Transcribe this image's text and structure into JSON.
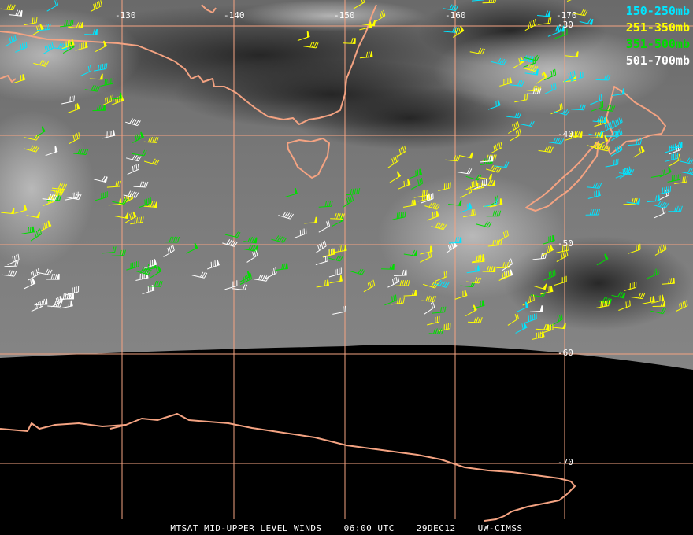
{
  "legend": [
    {
      "label": "150-250mb",
      "color": "#00e5ff"
    },
    {
      "label": "251-350mb",
      "color": "#ffff00"
    },
    {
      "label": "351-500mb",
      "color": "#00dd00"
    },
    {
      "label": "501-700mb",
      "color": "#ffffff"
    }
  ],
  "lon_labels": [
    "-130",
    "-140",
    "-150",
    "-160",
    "-170"
  ],
  "lat_labels": [
    "-30",
    "-40",
    "-50",
    "-60",
    "-70"
  ],
  "footer": {
    "product": "MTSAT MID-UPPER LEVEL WINDS",
    "time": "06:00 UTC",
    "date": "29DEC12",
    "source": "UW-CIMSS"
  },
  "colors": {
    "coastline": "#f4a382",
    "grid": "#f4a382",
    "background": "#000000"
  }
}
